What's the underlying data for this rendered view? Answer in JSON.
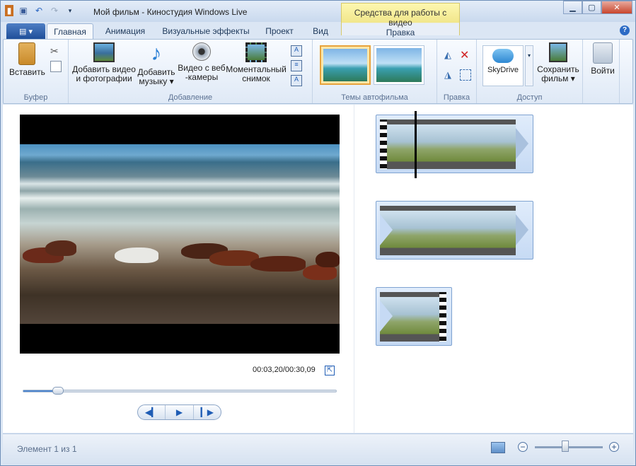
{
  "window": {
    "title": "Мой фильм - Киностудия Windows Live"
  },
  "context_tab": {
    "group_title": "Средства для работы с видео"
  },
  "tabs": [
    {
      "label": "Главная",
      "active": true
    },
    {
      "label": "Анимация"
    },
    {
      "label": "Визуальные эффекты"
    },
    {
      "label": "Проект"
    },
    {
      "label": "Вид"
    },
    {
      "label": "Правка"
    }
  ],
  "ribbon": {
    "clipboard": {
      "paste": "Вставить",
      "group": "Буфер"
    },
    "add": {
      "add_video": [
        "Добавить видео",
        "и фотографии"
      ],
      "add_music": [
        "Добавить",
        "музыку"
      ],
      "webcam": [
        "Видео с веб",
        "-камеры"
      ],
      "snapshot": [
        "Моментальный",
        "снимок"
      ],
      "group": "Добавление"
    },
    "themes": {
      "group": "Темы автофильма"
    },
    "edit": {
      "group": "Правка"
    },
    "share": {
      "skydrive": "SkyDrive",
      "save_movie": [
        "Сохранить",
        "фильм"
      ],
      "group": "Доступ"
    },
    "signin": {
      "label": "Войти"
    }
  },
  "player": {
    "timecode": "00:03,20/00:30,09",
    "progress": 0.11
  },
  "status": {
    "text": "Элемент 1 из 1",
    "zoom_level": 0.45
  },
  "colors": {
    "accent": "#1f5db5",
    "context_tab": "#f1e68b"
  }
}
